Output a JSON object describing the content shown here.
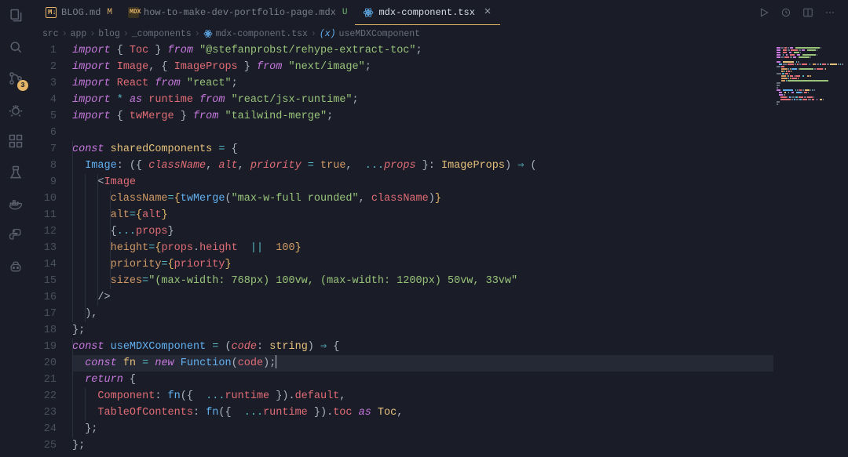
{
  "activity_bar": {
    "icons": [
      "files",
      "search",
      "source-control",
      "debug",
      "extensions",
      "testing",
      "docker",
      "python",
      "copilot"
    ],
    "source_control_badge": "3"
  },
  "tabs": [
    {
      "name": "BLOG.md",
      "icon": "markdown",
      "status": "M",
      "active": false
    },
    {
      "name": "how-to-make-dev-portfolio-page.mdx",
      "icon": "mdx",
      "status": "U",
      "active": false
    },
    {
      "name": "mdx-component.tsx",
      "icon": "react",
      "status": null,
      "active": true,
      "close": true
    }
  ],
  "tab_actions": [
    "run",
    "history",
    "split",
    "more"
  ],
  "breadcrumbs": {
    "path": [
      "src",
      "app",
      "blog",
      "_components"
    ],
    "file": "mdx-component.tsx",
    "symbol_icon": "(x)",
    "symbol": "useMDXComponent"
  },
  "code": {
    "lines": [
      [
        {
          "t": "import",
          "c": "kw"
        },
        {
          "t": " { ",
          "c": "punc"
        },
        {
          "t": "Toc",
          "c": "id"
        },
        {
          "t": " } ",
          "c": "punc"
        },
        {
          "t": "from",
          "c": "kw"
        },
        {
          "t": " ",
          "c": ""
        },
        {
          "t": "\"@stefanprobst/rehype-extract-toc\"",
          "c": "str"
        },
        {
          "t": ";",
          "c": "punc"
        }
      ],
      [
        {
          "t": "import",
          "c": "kw"
        },
        {
          "t": " ",
          "c": ""
        },
        {
          "t": "Image",
          "c": "id"
        },
        {
          "t": ", { ",
          "c": "punc"
        },
        {
          "t": "ImageProps",
          "c": "id"
        },
        {
          "t": " } ",
          "c": "punc"
        },
        {
          "t": "from",
          "c": "kw"
        },
        {
          "t": " ",
          "c": ""
        },
        {
          "t": "\"next/image\"",
          "c": "str"
        },
        {
          "t": ";",
          "c": "punc"
        }
      ],
      [
        {
          "t": "import",
          "c": "kw"
        },
        {
          "t": " ",
          "c": ""
        },
        {
          "t": "React",
          "c": "id"
        },
        {
          "t": " ",
          "c": ""
        },
        {
          "t": "from",
          "c": "kw"
        },
        {
          "t": " ",
          "c": ""
        },
        {
          "t": "\"react\"",
          "c": "str"
        },
        {
          "t": ";",
          "c": "punc"
        }
      ],
      [
        {
          "t": "import",
          "c": "kw"
        },
        {
          "t": " ",
          "c": ""
        },
        {
          "t": "*",
          "c": "op"
        },
        {
          "t": " ",
          "c": ""
        },
        {
          "t": "as",
          "c": "kw"
        },
        {
          "t": " ",
          "c": ""
        },
        {
          "t": "runtime",
          "c": "id"
        },
        {
          "t": " ",
          "c": ""
        },
        {
          "t": "from",
          "c": "kw"
        },
        {
          "t": " ",
          "c": ""
        },
        {
          "t": "\"react/jsx-runtime\"",
          "c": "str"
        },
        {
          "t": ";",
          "c": "punc"
        }
      ],
      [
        {
          "t": "import",
          "c": "kw"
        },
        {
          "t": " { ",
          "c": "punc"
        },
        {
          "t": "twMerge",
          "c": "id"
        },
        {
          "t": " } ",
          "c": "punc"
        },
        {
          "t": "from",
          "c": "kw"
        },
        {
          "t": " ",
          "c": ""
        },
        {
          "t": "\"tailwind-merge\"",
          "c": "str"
        },
        {
          "t": ";",
          "c": "punc"
        }
      ],
      [],
      [
        {
          "t": "const",
          "c": "kw"
        },
        {
          "t": " ",
          "c": ""
        },
        {
          "t": "sharedComponents",
          "c": "id2"
        },
        {
          "t": " ",
          "c": ""
        },
        {
          "t": "=",
          "c": "op"
        },
        {
          "t": " {",
          "c": "punc"
        }
      ],
      [
        {
          "t": "  ",
          "c": ""
        },
        {
          "t": "Image",
          "c": "fn"
        },
        {
          "t": ": ({ ",
          "c": "punc"
        },
        {
          "t": "className",
          "c": "param"
        },
        {
          "t": ", ",
          "c": "punc"
        },
        {
          "t": "alt",
          "c": "param"
        },
        {
          "t": ", ",
          "c": "punc"
        },
        {
          "t": "priority",
          "c": "param"
        },
        {
          "t": " ",
          "c": ""
        },
        {
          "t": "=",
          "c": "op"
        },
        {
          "t": " ",
          "c": ""
        },
        {
          "t": "true",
          "c": "prop"
        },
        {
          "t": ",  ",
          "c": "punc"
        },
        {
          "t": "...",
          "c": "op"
        },
        {
          "t": "props",
          "c": "param"
        },
        {
          "t": " }: ",
          "c": "punc"
        },
        {
          "t": "ImageProps",
          "c": "type"
        },
        {
          "t": ") ",
          "c": "punc"
        },
        {
          "t": "⇒",
          "c": "op"
        },
        {
          "t": " (",
          "c": "punc"
        }
      ],
      [
        {
          "t": "    <",
          "c": "punc"
        },
        {
          "t": "Image",
          "c": "jsx"
        }
      ],
      [
        {
          "t": "      ",
          "c": ""
        },
        {
          "t": "className",
          "c": "prop"
        },
        {
          "t": "=",
          "c": "op"
        },
        {
          "t": "{",
          "c": "punc2"
        },
        {
          "t": "twMerge",
          "c": "fn"
        },
        {
          "t": "(",
          "c": "punc"
        },
        {
          "t": "\"max-w-full rounded\"",
          "c": "str"
        },
        {
          "t": ", ",
          "c": "punc"
        },
        {
          "t": "className",
          "c": "id"
        },
        {
          "t": ")",
          "c": "punc"
        },
        {
          "t": "}",
          "c": "punc2"
        }
      ],
      [
        {
          "t": "      ",
          "c": ""
        },
        {
          "t": "alt",
          "c": "prop"
        },
        {
          "t": "=",
          "c": "op"
        },
        {
          "t": "{",
          "c": "punc2"
        },
        {
          "t": "alt",
          "c": "id"
        },
        {
          "t": "}",
          "c": "punc2"
        }
      ],
      [
        {
          "t": "      {",
          "c": "punc"
        },
        {
          "t": "...",
          "c": "op"
        },
        {
          "t": "props",
          "c": "id"
        },
        {
          "t": "}",
          "c": "punc"
        }
      ],
      [
        {
          "t": "      ",
          "c": ""
        },
        {
          "t": "height",
          "c": "prop"
        },
        {
          "t": "=",
          "c": "op"
        },
        {
          "t": "{",
          "c": "punc2"
        },
        {
          "t": "props",
          "c": "id"
        },
        {
          "t": ".",
          "c": "punc"
        },
        {
          "t": "height",
          "c": "id"
        },
        {
          "t": "  ",
          "c": ""
        },
        {
          "t": "||",
          "c": "op"
        },
        {
          "t": "  ",
          "c": ""
        },
        {
          "t": "100",
          "c": "num"
        },
        {
          "t": "}",
          "c": "punc2"
        }
      ],
      [
        {
          "t": "      ",
          "c": ""
        },
        {
          "t": "priority",
          "c": "prop"
        },
        {
          "t": "=",
          "c": "op"
        },
        {
          "t": "{",
          "c": "punc2"
        },
        {
          "t": "priority",
          "c": "id"
        },
        {
          "t": "}",
          "c": "punc2"
        }
      ],
      [
        {
          "t": "      ",
          "c": ""
        },
        {
          "t": "sizes",
          "c": "prop"
        },
        {
          "t": "=",
          "c": "op"
        },
        {
          "t": "\"(max-width: 768px) 100vw, (max-width: 1200px) 50vw, 33vw\"",
          "c": "str"
        }
      ],
      [
        {
          "t": "    />",
          "c": "punc"
        }
      ],
      [
        {
          "t": "  ),",
          "c": "punc"
        }
      ],
      [
        {
          "t": "};",
          "c": "punc"
        }
      ],
      [
        {
          "t": "const",
          "c": "kw"
        },
        {
          "t": " ",
          "c": ""
        },
        {
          "t": "useMDXComponent",
          "c": "fn"
        },
        {
          "t": " ",
          "c": ""
        },
        {
          "t": "=",
          "c": "op"
        },
        {
          "t": " (",
          "c": "punc"
        },
        {
          "t": "code",
          "c": "param"
        },
        {
          "t": ": ",
          "c": "punc"
        },
        {
          "t": "string",
          "c": "type"
        },
        {
          "t": ") ",
          "c": "punc"
        },
        {
          "t": "⇒",
          "c": "op"
        },
        {
          "t": " {",
          "c": "punc"
        }
      ],
      [
        {
          "t": "  ",
          "c": ""
        },
        {
          "t": "const",
          "c": "kw"
        },
        {
          "t": " ",
          "c": ""
        },
        {
          "t": "fn",
          "c": "id2"
        },
        {
          "t": " ",
          "c": ""
        },
        {
          "t": "=",
          "c": "op"
        },
        {
          "t": " ",
          "c": ""
        },
        {
          "t": "new",
          "c": "kw"
        },
        {
          "t": " ",
          "c": ""
        },
        {
          "t": "Function",
          "c": "fn"
        },
        {
          "t": "(",
          "c": "punc"
        },
        {
          "t": "code",
          "c": "id"
        },
        {
          "t": ");",
          "c": "punc"
        },
        {
          "cursor": true
        }
      ],
      [
        {
          "t": "  ",
          "c": ""
        },
        {
          "t": "return",
          "c": "kw"
        },
        {
          "t": " {",
          "c": "punc"
        }
      ],
      [
        {
          "t": "    ",
          "c": ""
        },
        {
          "t": "Component",
          "c": "id"
        },
        {
          "t": ": ",
          "c": "punc"
        },
        {
          "t": "fn",
          "c": "fn"
        },
        {
          "t": "({  ",
          "c": "punc"
        },
        {
          "t": "...",
          "c": "op"
        },
        {
          "t": "runtime",
          "c": "id"
        },
        {
          "t": " }).",
          "c": "punc"
        },
        {
          "t": "default",
          "c": "id"
        },
        {
          "t": ",",
          "c": "punc"
        }
      ],
      [
        {
          "t": "    ",
          "c": ""
        },
        {
          "t": "TableOfContents",
          "c": "id"
        },
        {
          "t": ": ",
          "c": "punc"
        },
        {
          "t": "fn",
          "c": "fn"
        },
        {
          "t": "({  ",
          "c": "punc"
        },
        {
          "t": "...",
          "c": "op"
        },
        {
          "t": "runtime",
          "c": "id"
        },
        {
          "t": " }).",
          "c": "punc"
        },
        {
          "t": "toc",
          "c": "id"
        },
        {
          "t": " ",
          "c": ""
        },
        {
          "t": "as",
          "c": "kw"
        },
        {
          "t": " ",
          "c": ""
        },
        {
          "t": "Toc",
          "c": "type"
        },
        {
          "t": ",",
          "c": "punc"
        }
      ],
      [
        {
          "t": "  };",
          "c": "punc"
        }
      ],
      [
        {
          "t": "};",
          "c": "punc"
        }
      ]
    ],
    "highlight_line": 20,
    "indent_guides": {
      "7": [
        0
      ],
      "8": [
        0
      ],
      "9": [
        0,
        1,
        2
      ],
      "10": [
        0,
        1,
        2,
        3
      ],
      "11": [
        0,
        1,
        2,
        3
      ],
      "12": [
        0,
        1,
        2,
        3
      ],
      "13": [
        0,
        1,
        2,
        3
      ],
      "14": [
        0,
        1,
        2,
        3
      ],
      "15": [
        0,
        1,
        2,
        3
      ],
      "16": [
        0,
        1,
        2
      ],
      "17": [
        0,
        1
      ],
      "19": [
        0
      ],
      "20": [
        0
      ],
      "21": [
        0
      ],
      "22": [
        0,
        1
      ],
      "23": [
        0,
        1
      ],
      "24": [
        0
      ]
    }
  }
}
